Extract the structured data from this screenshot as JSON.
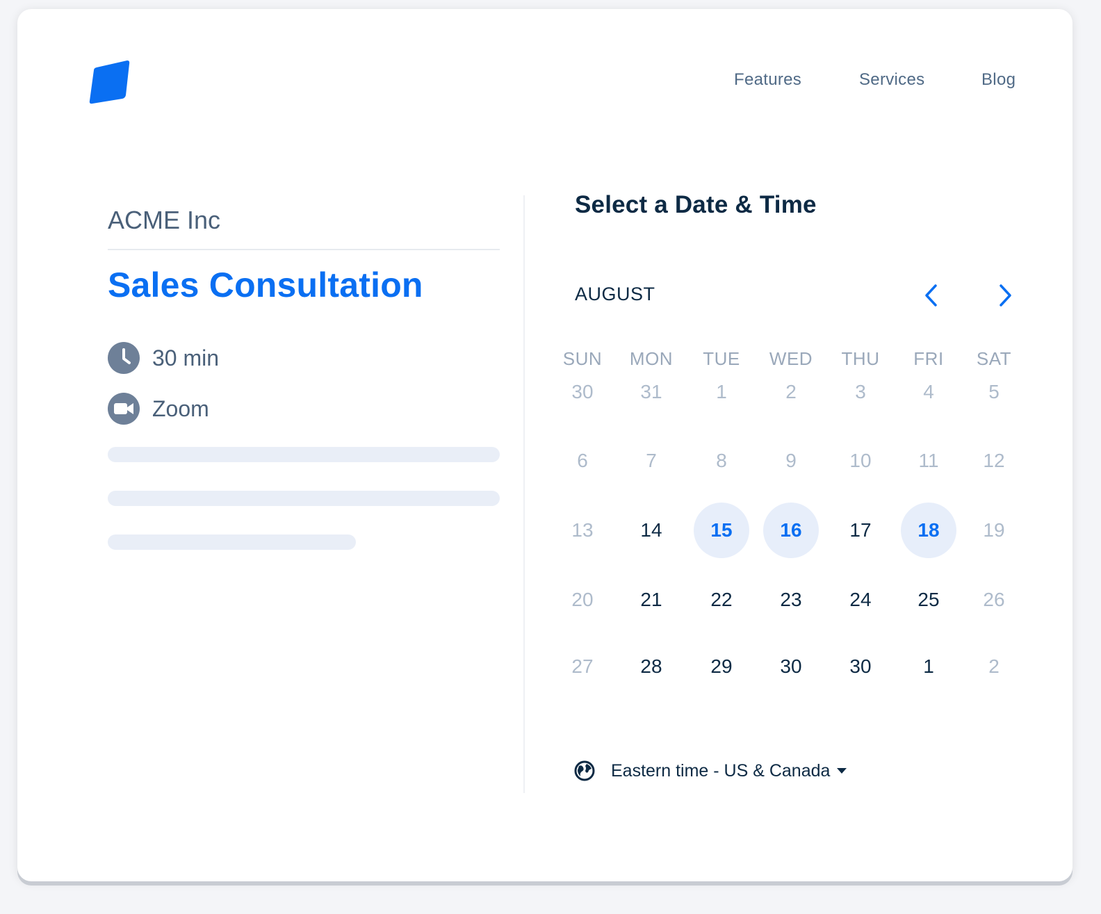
{
  "nav": {
    "logo_icon": "brand-logo-icon",
    "links": [
      "Features",
      "Services",
      "Blog"
    ]
  },
  "event": {
    "company": "ACME Inc",
    "title": "Sales Consultation",
    "duration": "30 min",
    "location": "Zoom",
    "duration_icon": "clock-icon",
    "location_icon": "video-camera-icon"
  },
  "picker": {
    "heading": "Select a Date & Time",
    "month": "AUGUST",
    "prev_icon": "chevron-left-icon",
    "next_icon": "chevron-right-icon",
    "weekdays": [
      "SUN",
      "MON",
      "TUE",
      "WED",
      "THU",
      "FRI",
      "SAT"
    ],
    "weeks": [
      [
        {
          "d": "30",
          "s": "muted"
        },
        {
          "d": "31",
          "s": "muted"
        },
        {
          "d": "1",
          "s": "muted"
        },
        {
          "d": "2",
          "s": "muted"
        },
        {
          "d": "3",
          "s": "muted"
        },
        {
          "d": "4",
          "s": "muted"
        },
        {
          "d": "5",
          "s": "muted"
        }
      ],
      [
        {
          "d": "6",
          "s": "muted"
        },
        {
          "d": "7",
          "s": "muted"
        },
        {
          "d": "8",
          "s": "muted"
        },
        {
          "d": "9",
          "s": "muted"
        },
        {
          "d": "10",
          "s": "muted"
        },
        {
          "d": "11",
          "s": "muted"
        },
        {
          "d": "12",
          "s": "muted"
        }
      ],
      [
        {
          "d": "13",
          "s": "muted"
        },
        {
          "d": "14",
          "s": "normal"
        },
        {
          "d": "15",
          "s": "avail"
        },
        {
          "d": "16",
          "s": "avail"
        },
        {
          "d": "17",
          "s": "normal"
        },
        {
          "d": "18",
          "s": "avail"
        },
        {
          "d": "19",
          "s": "muted"
        }
      ],
      [
        {
          "d": "20",
          "s": "muted"
        },
        {
          "d": "21",
          "s": "normal"
        },
        {
          "d": "22",
          "s": "normal"
        },
        {
          "d": "23",
          "s": "normal"
        },
        {
          "d": "24",
          "s": "normal"
        },
        {
          "d": "25",
          "s": "normal"
        },
        {
          "d": "26",
          "s": "muted"
        }
      ],
      [
        {
          "d": "27",
          "s": "muted"
        },
        {
          "d": "28",
          "s": "normal"
        },
        {
          "d": "29",
          "s": "normal"
        },
        {
          "d": "30",
          "s": "normal"
        },
        {
          "d": "30",
          "s": "normal"
        },
        {
          "d": "1",
          "s": "normal"
        },
        {
          "d": "2",
          "s": "muted"
        }
      ]
    ],
    "timezone": "Eastern time - US & Canada",
    "timezone_icon": "globe-icon"
  },
  "colors": {
    "accent": "#0a6ff2",
    "text_dark": "#0d2a44",
    "text_muted": "#aebbcb",
    "available_bg": "#e7eefa"
  }
}
